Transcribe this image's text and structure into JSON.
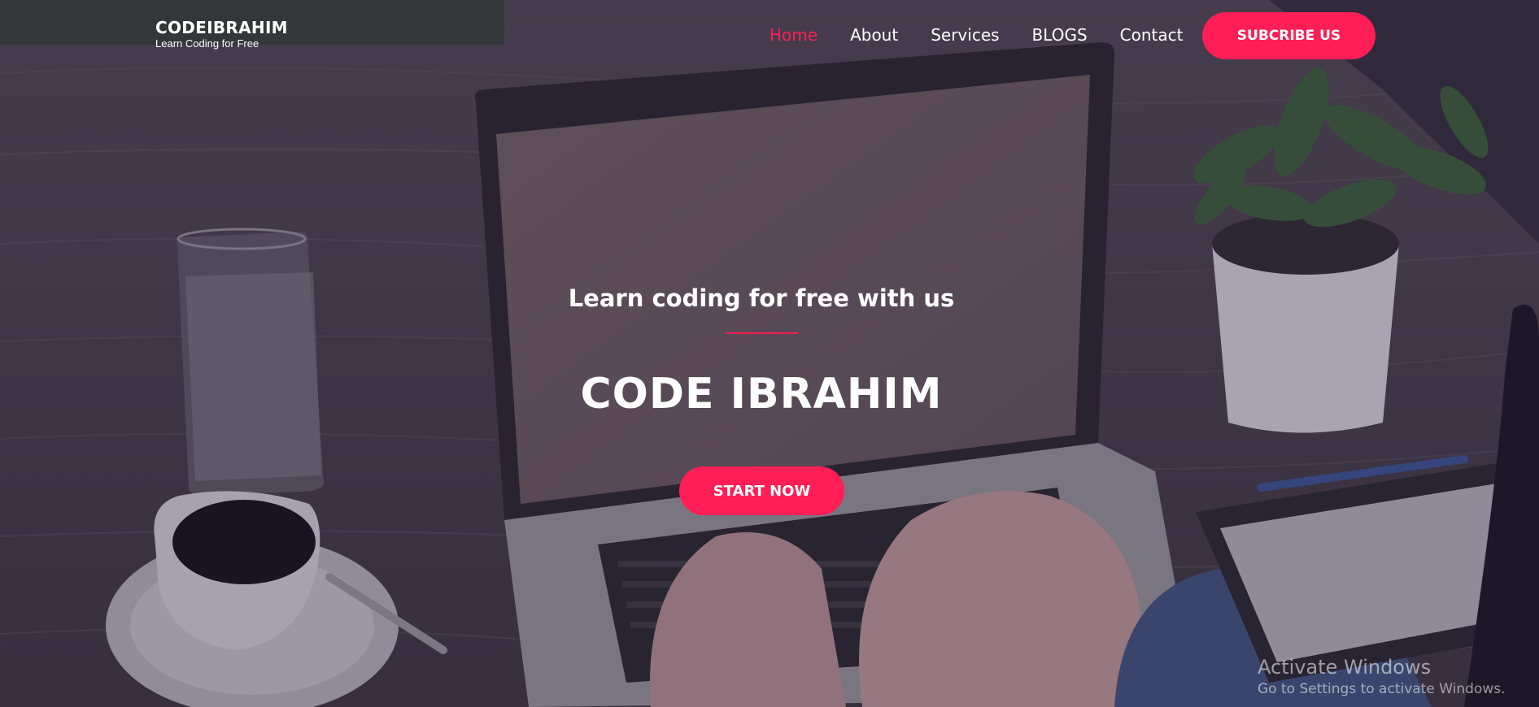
{
  "brand": {
    "title": "CODEIBRAHIM",
    "tagline": "Learn Coding for Free"
  },
  "nav": {
    "items": [
      {
        "label": "Home",
        "active": true
      },
      {
        "label": "About",
        "active": false
      },
      {
        "label": "Services",
        "active": false
      },
      {
        "label": "BLOGS",
        "active": false
      },
      {
        "label": "Contact",
        "active": false
      }
    ],
    "subscribe_label": "SUBCRIBE US"
  },
  "hero": {
    "subtitle": "Learn coding for free with us",
    "headline": "CODE IBRAHIM",
    "cta_label": "START NOW",
    "background_icon": "laptop-desk-photo"
  },
  "watermark": {
    "title": "Activate Windows",
    "subtitle": "Go to Settings to activate Windows."
  },
  "colors": {
    "accent": "#ff1e56",
    "text": "#ffffff"
  }
}
